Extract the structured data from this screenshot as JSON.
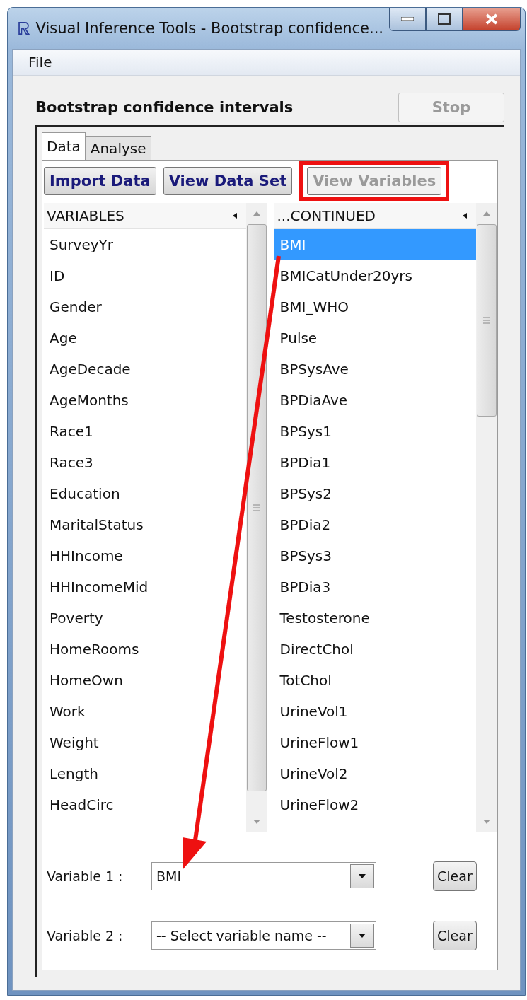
{
  "window": {
    "title": "Visual Inference Tools - Bootstrap confidence..."
  },
  "menu": [
    "File"
  ],
  "heading": "Bootstrap confidence intervals",
  "stop_button": {
    "label": "Stop",
    "disabled": true
  },
  "tabs": [
    {
      "label": "Data",
      "selected": true
    },
    {
      "label": "Analyse",
      "selected": false
    }
  ],
  "toolbar": [
    {
      "label": "Import Data",
      "disabled": false,
      "highlighted": false
    },
    {
      "label": "View Data Set",
      "disabled": false,
      "highlighted": false
    },
    {
      "label": "View Variables",
      "disabled": true,
      "highlighted": true
    }
  ],
  "lists": [
    {
      "header": "VARIABLES",
      "items": [
        {
          "label": "SurveyYr",
          "selected": false
        },
        {
          "label": "ID",
          "selected": false
        },
        {
          "label": "Gender",
          "selected": false
        },
        {
          "label": "Age",
          "selected": false
        },
        {
          "label": "AgeDecade",
          "selected": false
        },
        {
          "label": "AgeMonths",
          "selected": false
        },
        {
          "label": "Race1",
          "selected": false
        },
        {
          "label": "Race3",
          "selected": false
        },
        {
          "label": "Education",
          "selected": false
        },
        {
          "label": "MaritalStatus",
          "selected": false
        },
        {
          "label": "HHIncome",
          "selected": false
        },
        {
          "label": "HHIncomeMid",
          "selected": false
        },
        {
          "label": "Poverty",
          "selected": false
        },
        {
          "label": "HomeRooms",
          "selected": false
        },
        {
          "label": "HomeOwn",
          "selected": false
        },
        {
          "label": "Work",
          "selected": false
        },
        {
          "label": "Weight",
          "selected": false
        },
        {
          "label": "Length",
          "selected": false
        },
        {
          "label": "HeadCirc",
          "selected": false
        }
      ]
    },
    {
      "header": "...CONTINUED",
      "items": [
        {
          "label": "BMI",
          "selected": true
        },
        {
          "label": "BMICatUnder20yrs",
          "selected": false
        },
        {
          "label": "BMI_WHO",
          "selected": false
        },
        {
          "label": "Pulse",
          "selected": false
        },
        {
          "label": "BPSysAve",
          "selected": false
        },
        {
          "label": "BPDiaAve",
          "selected": false
        },
        {
          "label": "BPSys1",
          "selected": false
        },
        {
          "label": "BPDia1",
          "selected": false
        },
        {
          "label": "BPSys2",
          "selected": false
        },
        {
          "label": "BPDia2",
          "selected": false
        },
        {
          "label": "BPSys3",
          "selected": false
        },
        {
          "label": "BPDia3",
          "selected": false
        },
        {
          "label": "Testosterone",
          "selected": false
        },
        {
          "label": "DirectChol",
          "selected": false
        },
        {
          "label": "TotChol",
          "selected": false
        },
        {
          "label": "UrineVol1",
          "selected": false
        },
        {
          "label": "UrineFlow1",
          "selected": false
        },
        {
          "label": "UrineVol2",
          "selected": false
        },
        {
          "label": "UrineFlow2",
          "selected": false
        }
      ]
    }
  ],
  "selectors": [
    {
      "label": "Variable 1 :",
      "value": "BMI",
      "clear": "Clear"
    },
    {
      "label": "Variable 2 :",
      "placeholder": "-- Select variable name --",
      "clear": "Clear"
    }
  ]
}
